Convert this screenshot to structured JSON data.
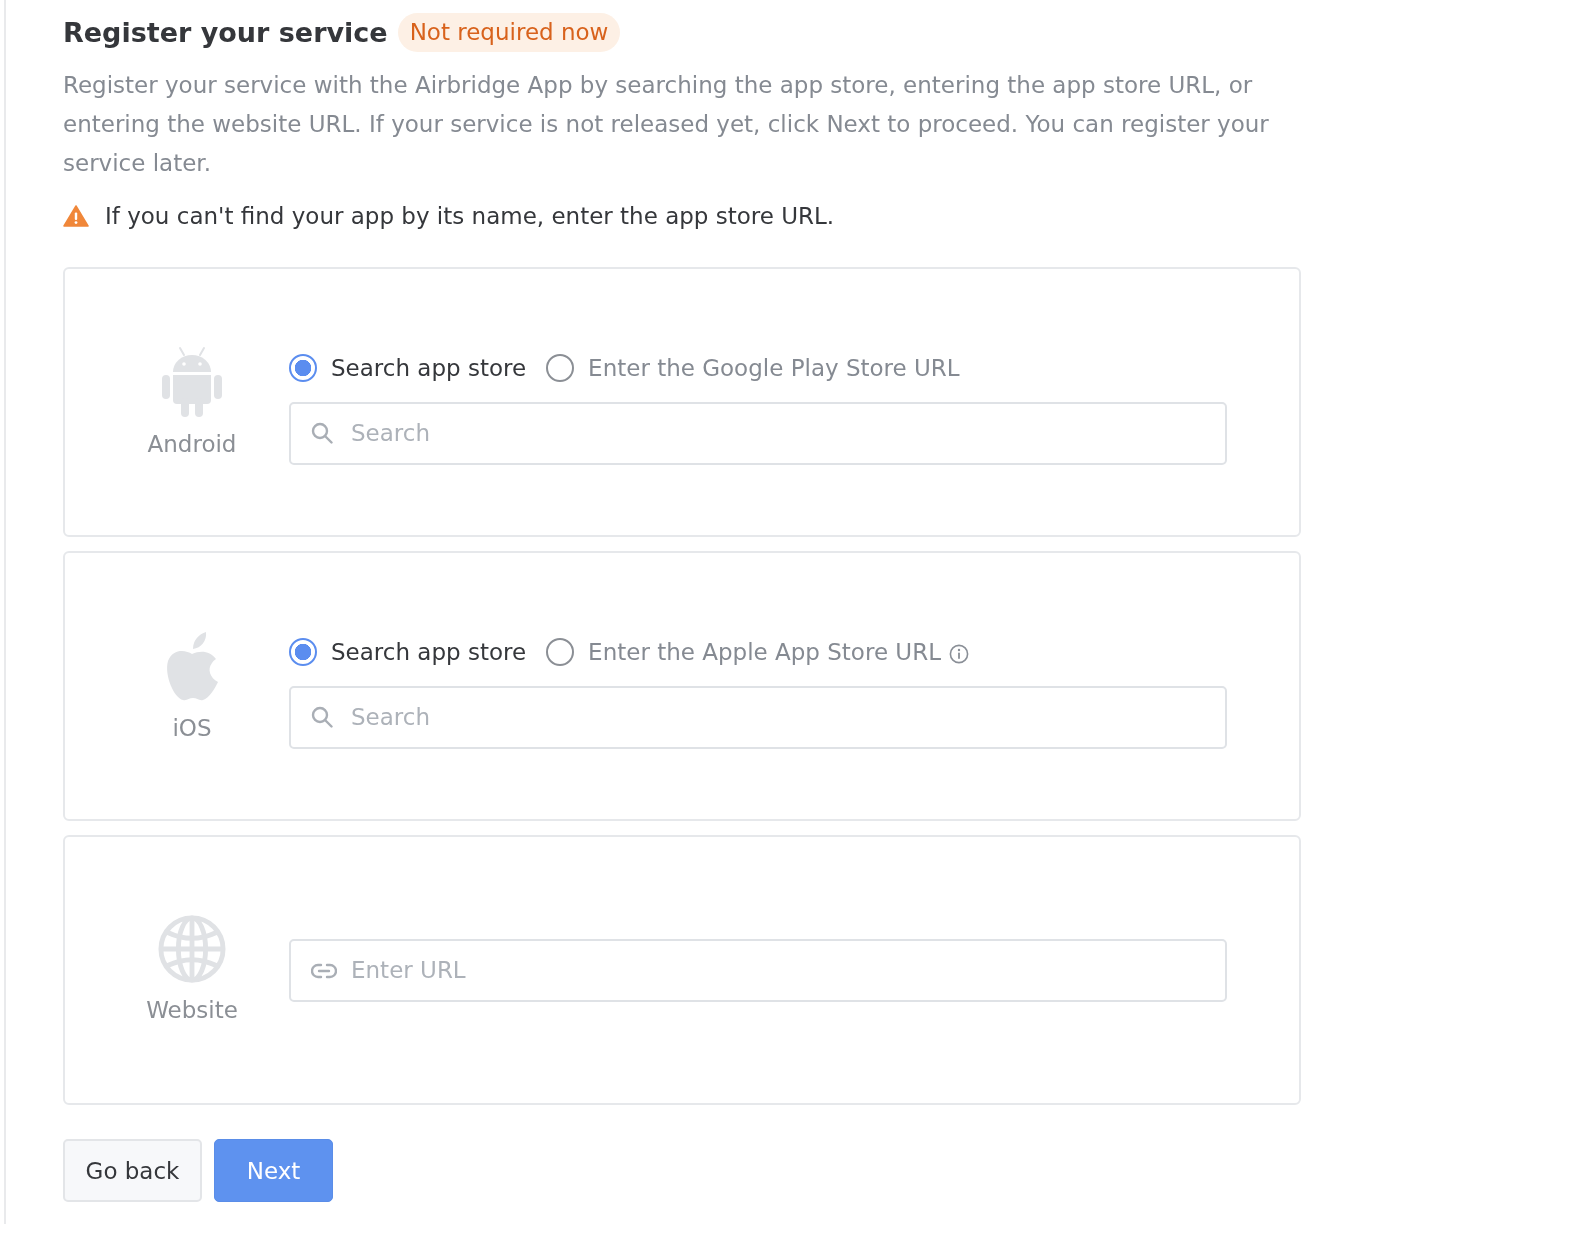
{
  "header": {
    "title": "Register your service",
    "badge": "Not required now"
  },
  "description": "Register your service with the Airbridge App by searching the app store, entering the app store URL, or entering the website URL. If your service is not released yet, click Next to proceed. You can register your service later.",
  "warning": "If you can't find your app by its name, enter the app store URL.",
  "platforms": [
    {
      "kind": "android",
      "name": "Android",
      "options": [
        {
          "label": "Search app store",
          "selected": true,
          "info": false
        },
        {
          "label": "Enter the Google Play Store URL",
          "selected": false,
          "info": false
        }
      ],
      "field": {
        "placeholder": "Search"
      }
    },
    {
      "kind": "ios",
      "name": "iOS",
      "options": [
        {
          "label": "Search app store",
          "selected": true,
          "info": false
        },
        {
          "label": "Enter the Apple App Store URL",
          "selected": false,
          "info": true
        }
      ],
      "field": {
        "placeholder": "Search"
      }
    },
    {
      "kind": "web",
      "name": "Website",
      "field": {
        "placeholder": "Enter URL"
      }
    }
  ],
  "buttons": [
    {
      "label": "Go back",
      "kind": "secondary"
    },
    {
      "label": "Next",
      "kind": "primary"
    }
  ]
}
